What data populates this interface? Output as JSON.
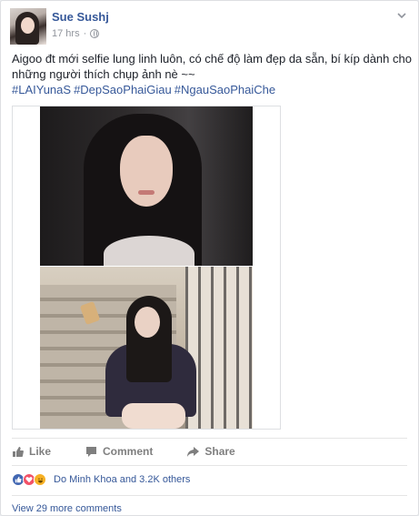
{
  "post": {
    "author": "Sue Sushj",
    "time": "17 hrs",
    "dot": "·",
    "privacy_icon": "globe-icon",
    "menu_icon": "chevron-down-icon",
    "text": "Aigoo đt mới selfie lung linh luôn, có chế độ làm đẹp da sẵn, bí kíp dành cho những người thích chụp ảnh nè ~~",
    "hashtags": [
      "#LAIYunaS",
      "#DepSaoPhaiGiau",
      "#NgauSaoPhaiChe"
    ]
  },
  "actions": {
    "like": "Like",
    "comment": "Comment",
    "share": "Share"
  },
  "reactions": {
    "icons": [
      "like-icon",
      "love-icon",
      "haha-icon"
    ],
    "summary": "Do Minh Khoa and 3.2K others"
  },
  "comments": {
    "view_more": "View 29 more comments"
  },
  "colors": {
    "link": "#365899",
    "muted": "#90949c",
    "like": "#4267b2",
    "love": "#f25268",
    "haha": "#f7b125"
  }
}
